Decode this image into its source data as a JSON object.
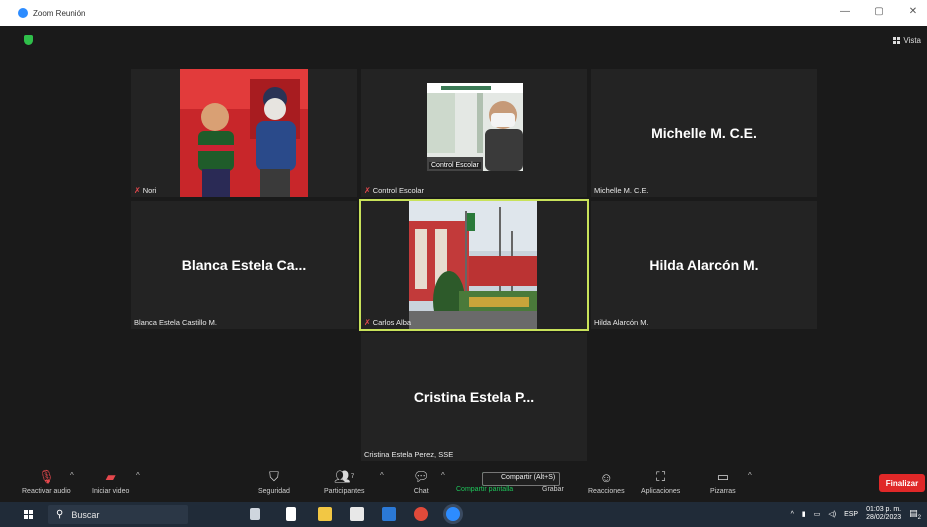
{
  "window": {
    "title": "Zoom Reunión",
    "minimize": "—",
    "maximize": "▢",
    "close": "✕"
  },
  "view": {
    "label": "Vista"
  },
  "participants": [
    {
      "name": "Nori",
      "muted": true,
      "display": ""
    },
    {
      "name": "Control Escolar",
      "muted": true,
      "display": "",
      "video_caption": "Control Escolar"
    },
    {
      "name": "Michelle M. C.E.",
      "muted": false,
      "display": "Michelle M. C.E."
    },
    {
      "name": "Blanca Estela Castillo M.",
      "muted": false,
      "display": "Blanca Estela Ca..."
    },
    {
      "name": "Carlos Alba",
      "muted": true,
      "display": "",
      "active_speaker": true
    },
    {
      "name": "Hilda Alarcón M.",
      "muted": false,
      "display": "Hilda Alarcón M."
    },
    {
      "name": "Cristina Estela Perez, SSE",
      "muted": false,
      "display": "Cristina Estela P..."
    }
  ],
  "toolbar": {
    "audio": "Reactivar audio",
    "video": "Iniciar video",
    "security": "Seguridad",
    "participants": "Participantes",
    "participants_count": "7",
    "chat": "Chat",
    "share": "Compartir pantalla",
    "share_tooltip": "Compartir (Alt+S)",
    "record": "Grabar",
    "reactions": "Reacciones",
    "apps": "Aplicaciones",
    "whiteboards": "Pizarras",
    "end": "Finalizar"
  },
  "taskbar": {
    "search_placeholder": "Buscar",
    "language": "ESP",
    "time": "01:03 p. m.",
    "date": "28/02/2023",
    "notifications": "2"
  },
  "colors": {
    "active_border": "#c8e25a",
    "end_button": "#e02828",
    "share_green": "#1ec45a",
    "zoom_blue": "#2d8cff"
  }
}
